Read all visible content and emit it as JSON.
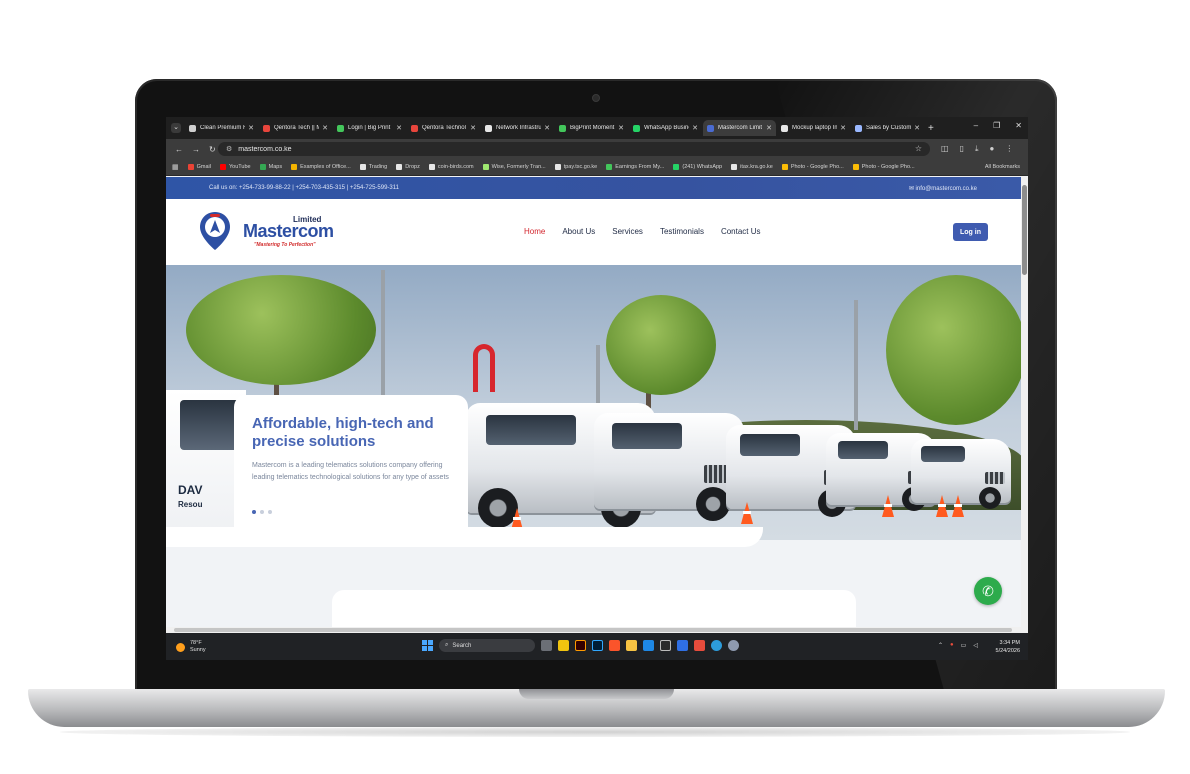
{
  "browser": {
    "tabs": [
      {
        "label": "Clean Premium F",
        "color": "#cfcfcf"
      },
      {
        "label": "Qentora Tech || M",
        "color": "#e8453c"
      },
      {
        "label": "Login | Big Print",
        "color": "#43c65b"
      },
      {
        "label": "Qentora Technol",
        "color": "#e8453c"
      },
      {
        "label": "Network Infrastru",
        "color": "#e6e6e6"
      },
      {
        "label": "BigPrint Moment",
        "color": "#43c65b"
      },
      {
        "label": "WhatsApp Busine",
        "color": "#25d366"
      },
      {
        "label": "Mastercom Limit",
        "color": "#4a6bd1",
        "active": true
      },
      {
        "label": "Mockup laptop Im",
        "color": "#e6e6e6"
      },
      {
        "label": "Sales by Custome",
        "color": "#9ab8ff"
      }
    ],
    "url": "mastercom.co.ke",
    "bookmarks": [
      {
        "label": "Gmail",
        "color": "#ea4335"
      },
      {
        "label": "YouTube",
        "color": "#ff0000"
      },
      {
        "label": "Maps",
        "color": "#34a853"
      },
      {
        "label": "Examples of Office...",
        "color": "#f4b400"
      },
      {
        "label": "Trading",
        "color": "#e6e6e6"
      },
      {
        "label": "Dropz",
        "color": "#e6e6e6"
      },
      {
        "label": "coin-birds.com",
        "color": "#e6e6e6"
      },
      {
        "label": "Wise, Formerly Tran...",
        "color": "#9fe870"
      },
      {
        "label": "tpay.tsc.go.ke",
        "color": "#e6e6e6"
      },
      {
        "label": "Earnings From My...",
        "color": "#43c65b"
      },
      {
        "label": "(241) WhatsApp",
        "color": "#25d366"
      },
      {
        "label": "itax.kra.go.ke",
        "color": "#e6e6e6"
      },
      {
        "label": "Photo - Google Pho...",
        "color": "#fbbc05"
      },
      {
        "label": "Photo - Google Pho...",
        "color": "#fbbc05"
      }
    ],
    "all_bookmarks": "All Bookmarks"
  },
  "site": {
    "topbar_call": "Call us on: +254-733-99-88-22 | +254-703-435-315 | +254-725-599-311",
    "topbar_email": "info@mastercom.co.ke",
    "logo_limited": "Limited",
    "logo_name": "Mastercom",
    "logo_tagline": "\"Mastering To Perfection\"",
    "nav": [
      "Home",
      "About Us",
      "Services",
      "Testimonials",
      "Contact Us"
    ],
    "login_label": "Log in",
    "hero_title": "Affordable, high-tech and precise solutions",
    "hero_text": "Mastercom is a leading telematics solutions company offering leading telematics technological solutions for any type of assets",
    "van_text": "DAV",
    "van_text2": "Resou"
  },
  "taskbar": {
    "temp": "78°F",
    "condition": "Sunny",
    "search_placeholder": "Search",
    "time": "3:34 PM",
    "date": "5/24/2026"
  },
  "colors": {
    "brand_blue": "#3f5bb0",
    "accent_red": "#d3262e",
    "whatsapp_green": "#2dab4c"
  }
}
